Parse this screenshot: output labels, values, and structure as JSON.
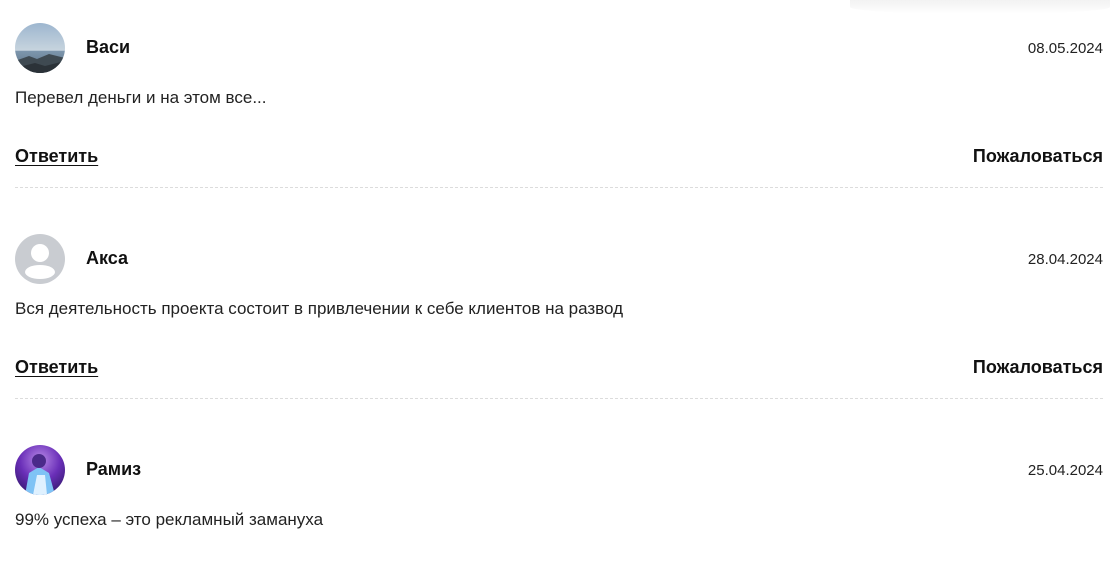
{
  "comments": [
    {
      "author": "Васи",
      "date": "08.05.2024",
      "text": "Перевел деньги и на этом все...",
      "reply_label": "Ответить",
      "report_label": "Пожаловаться",
      "avatar": "photo-sea-avatar"
    },
    {
      "author": "Акса",
      "date": "28.04.2024",
      "text": "Вся деятельность проекта состоит в привлечении к себе клиентов на развод",
      "reply_label": "Ответить",
      "report_label": "Пожаловаться",
      "avatar": "default-user-avatar"
    },
    {
      "author": "Рамиз",
      "date": "25.04.2024",
      "text": "99% успеха – это рекламный замануха",
      "avatar": "photo-purple-avatar"
    }
  ],
  "colors": {
    "text": "#222222",
    "divider": "#dcdcdc",
    "default_avatar_bg": "#c9ccd1"
  }
}
